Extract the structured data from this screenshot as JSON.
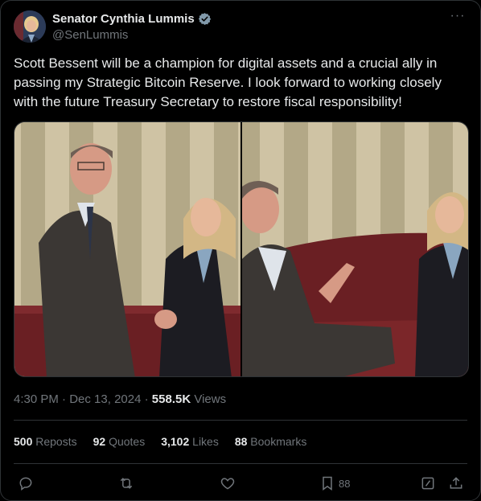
{
  "author": {
    "display_name": "Senator Cynthia Lummis",
    "handle": "@SenLummis",
    "verified_icon": "verified-badge-icon"
  },
  "tweet": {
    "text": "Scott Bessent will be a champion for digital assets and a crucial ally in passing my Strategic Bitcoin Reserve. I look forward to working closely with the future Treasury Secretary to restore fiscal responsibility!"
  },
  "meta": {
    "time": "4:30 PM",
    "separator1": " · ",
    "date": "Dec 13, 2024",
    "separator2": " · ",
    "views_count": "558.5K",
    "views_label": " Views"
  },
  "stats": [
    {
      "count": "500",
      "label": " Reposts"
    },
    {
      "count": "92",
      "label": " Quotes"
    },
    {
      "count": "3,102",
      "label": " Likes"
    },
    {
      "count": "88",
      "label": " Bookmarks"
    }
  ],
  "actions": {
    "reply_icon": "reply-icon",
    "repost_icon": "repost-icon",
    "like_icon": "like-icon",
    "bookmark_icon": "bookmark-icon",
    "bookmark_count": "88",
    "grok_icon": "grok-icon",
    "share_icon": "share-icon"
  },
  "colors": {
    "background": "#000000",
    "text": "#e7e9ea",
    "secondary": "#71767b",
    "verified": "#829aab",
    "border": "#2f3336"
  }
}
